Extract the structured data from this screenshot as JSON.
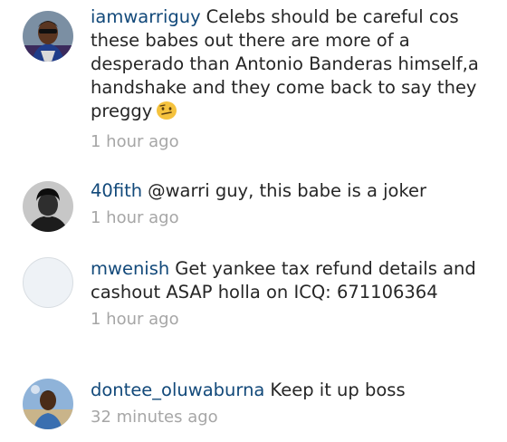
{
  "comments": [
    {
      "username": "iamwarriguy",
      "text": "Celebs should be careful cos these babes out there are more of a desperado than Antonio Banderas himself,a handshake and they come back to say they preggy",
      "emoji": "confused-face-emoji",
      "time": "1 hour ago"
    },
    {
      "username": "40fith",
      "text": "@warri guy, this babe is a joker",
      "time": "1 hour ago"
    },
    {
      "username": "mwenish",
      "text": "Get yankee tax refund details and cashout ASAP holla on ICQ: 671106364",
      "time": "1 hour ago"
    },
    {
      "username": "dontee_oluwaburna",
      "text": "Keep it up boss",
      "time": "32 minutes ago"
    }
  ],
  "colors": {
    "username": "#12497a",
    "text": "#262626",
    "time": "#a6a6a6"
  }
}
